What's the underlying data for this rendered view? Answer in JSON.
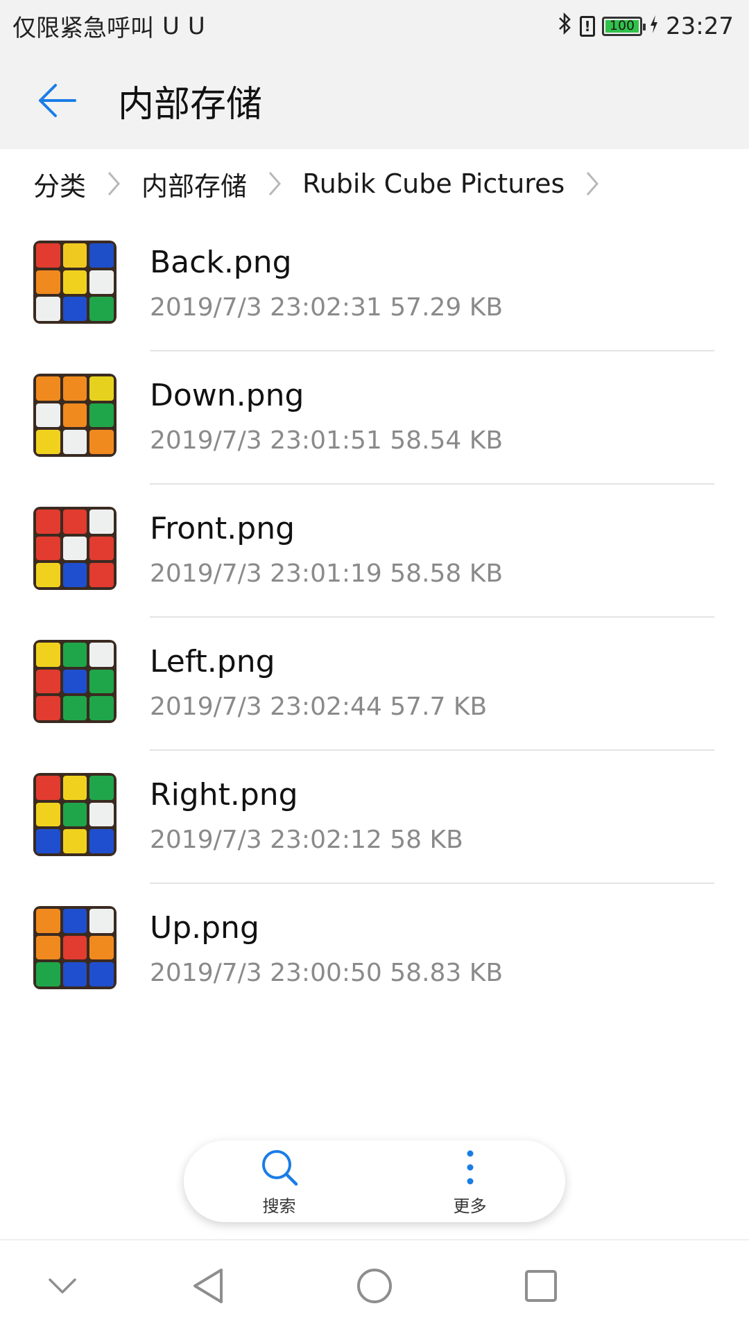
{
  "status_bar": {
    "carrier_text": "仅限紧急呼叫",
    "usb_icons": [
      "usb-icon",
      "usb-icon"
    ],
    "battery_level": "100",
    "time": "23:27"
  },
  "app_bar": {
    "title": "内部存储"
  },
  "breadcrumb": {
    "items": [
      "分类",
      "内部存储",
      "Rubik Cube Pictures"
    ]
  },
  "files": [
    {
      "name": "Back.png",
      "meta": "2019/7/3 23:02:31 57.29 KB",
      "thumb_colors": [
        "#e23b2f",
        "#f0c920",
        "#1e4fc8",
        "#f08a1f",
        "#f0d21e",
        "#eef0f0",
        "#eef0f0",
        "#1f4fcf",
        "#1fa64a"
      ]
    },
    {
      "name": "Down.png",
      "meta": "2019/7/3 23:01:51 58.54 KB",
      "thumb_colors": [
        "#f08a1f",
        "#f08a1f",
        "#e6d21e",
        "#eef0f0",
        "#f08a1f",
        "#1fa64a",
        "#f0d21e",
        "#eef0f0",
        "#f08a1f"
      ]
    },
    {
      "name": "Front.png",
      "meta": "2019/7/3 23:01:19 58.58 KB",
      "thumb_colors": [
        "#e23b2f",
        "#e23b2f",
        "#eef0f0",
        "#e23b2f",
        "#eef0f0",
        "#e23b2f",
        "#f0d21e",
        "#1f4fcf",
        "#e23b2f"
      ]
    },
    {
      "name": "Left.png",
      "meta": "2019/7/3 23:02:44 57.7 KB",
      "thumb_colors": [
        "#f0d21e",
        "#1fa64a",
        "#eef0f0",
        "#e23b2f",
        "#1f4fcf",
        "#1fa64a",
        "#e23b2f",
        "#1fa64a",
        "#1fa64a"
      ]
    },
    {
      "name": "Right.png",
      "meta": "2019/7/3 23:02:12 58 KB",
      "thumb_colors": [
        "#e23b2f",
        "#f0d21e",
        "#1fa64a",
        "#f0d21e",
        "#1fa64a",
        "#eef0f0",
        "#1f4fcf",
        "#f0d21e",
        "#1f4fcf"
      ]
    },
    {
      "name": "Up.png",
      "meta": "2019/7/3 23:00:50 58.83 KB",
      "thumb_colors": [
        "#f08a1f",
        "#1f4fcf",
        "#eef0f0",
        "#f08a1f",
        "#e23b2f",
        "#f08a1f",
        "#1fa64a",
        "#1f4fcf",
        "#1f4fcf"
      ]
    }
  ],
  "toolbar": {
    "search_label": "搜索",
    "more_label": "更多"
  },
  "colors": {
    "accent": "#1a7de6",
    "secondary_text": "#8a8a8a",
    "bar_background": "#f2f2f2"
  }
}
